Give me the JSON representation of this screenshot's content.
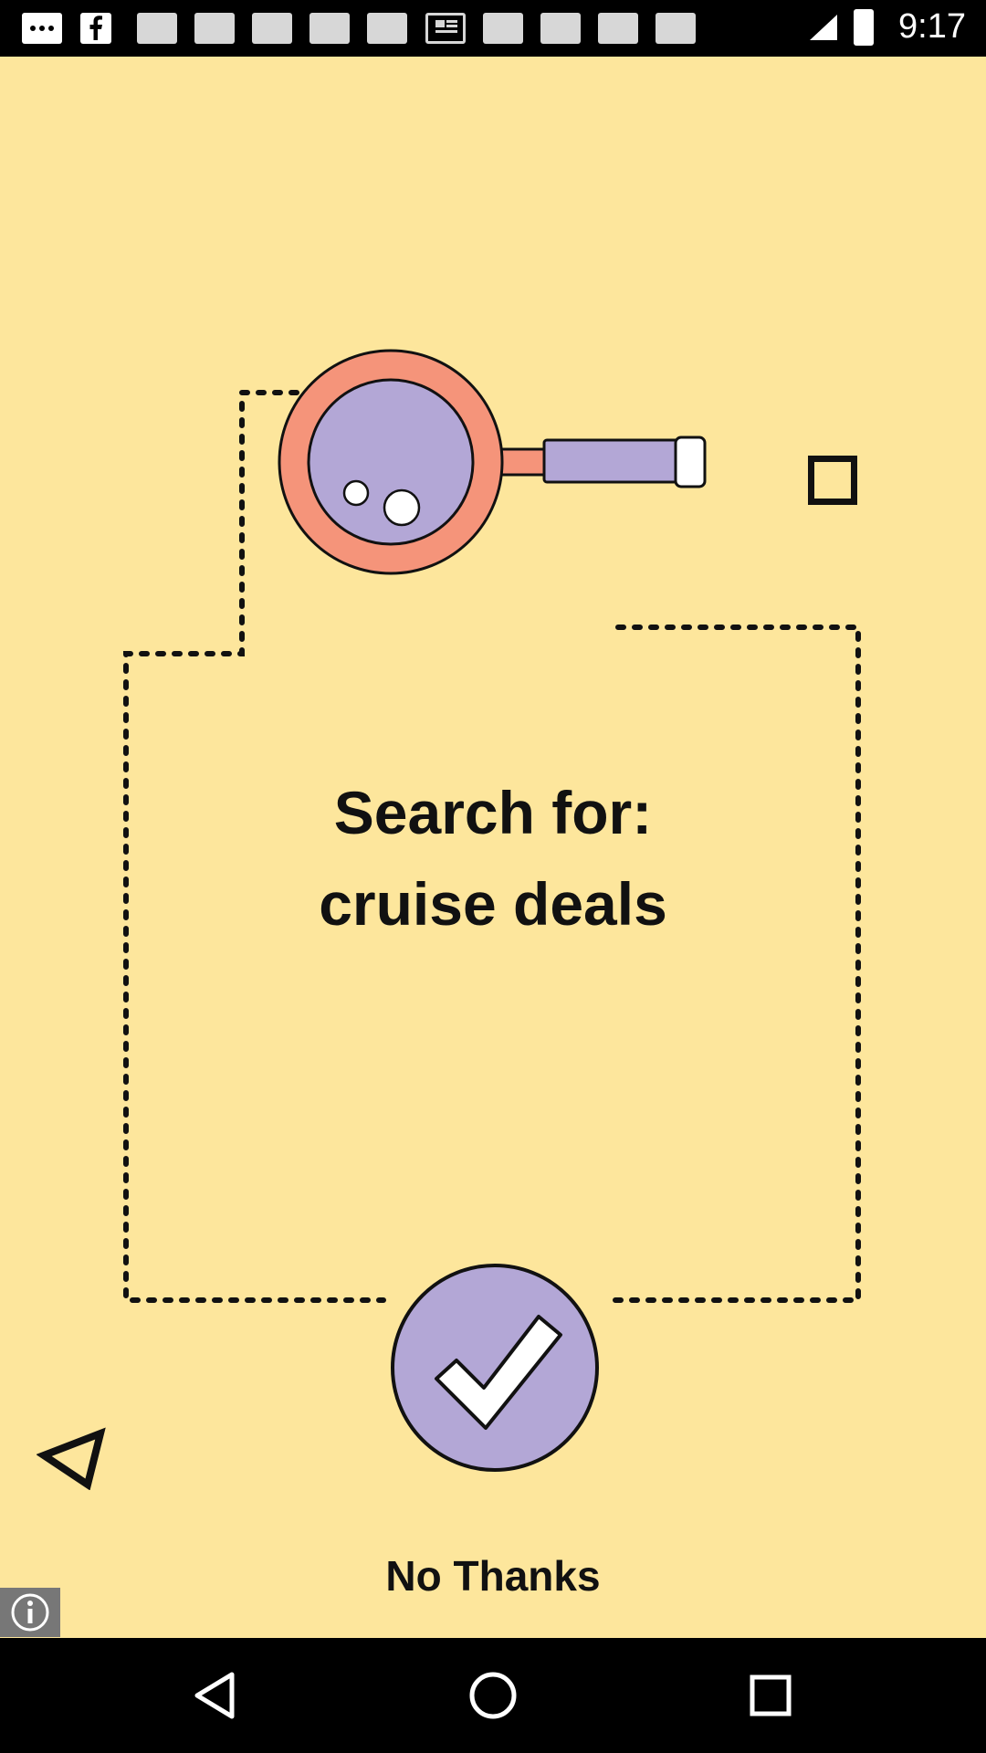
{
  "status_bar": {
    "time": "9:17",
    "icons": [
      "more-icon",
      "facebook-icon",
      "notification-icon",
      "notification-icon",
      "notification-icon",
      "notification-icon",
      "notification-icon",
      "news-icon",
      "notification-icon",
      "notification-icon",
      "notification-icon",
      "notification-icon"
    ]
  },
  "main": {
    "headline_line1": "Search for:",
    "headline_line2": "cruise deals",
    "no_thanks_label": "No Thanks"
  },
  "colors": {
    "background": "#fde69c",
    "accent_orange": "#f5947a",
    "accent_lavender": "#b3a7d6",
    "text": "#111111"
  },
  "nav_bar": {
    "buttons": [
      "back-icon",
      "home-icon",
      "recents-icon"
    ]
  }
}
